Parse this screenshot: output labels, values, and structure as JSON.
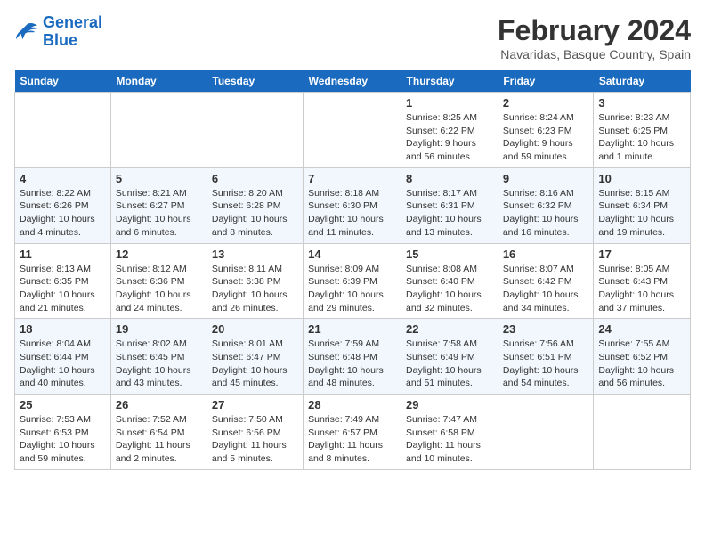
{
  "logo": {
    "line1": "General",
    "line2": "Blue"
  },
  "title": "February 2024",
  "subtitle": "Navaridas, Basque Country, Spain",
  "weekdays": [
    "Sunday",
    "Monday",
    "Tuesday",
    "Wednesday",
    "Thursday",
    "Friday",
    "Saturday"
  ],
  "weeks": [
    [
      {
        "day": "",
        "info": ""
      },
      {
        "day": "",
        "info": ""
      },
      {
        "day": "",
        "info": ""
      },
      {
        "day": "",
        "info": ""
      },
      {
        "day": "1",
        "info": "Sunrise: 8:25 AM\nSunset: 6:22 PM\nDaylight: 9 hours and 56 minutes."
      },
      {
        "day": "2",
        "info": "Sunrise: 8:24 AM\nSunset: 6:23 PM\nDaylight: 9 hours and 59 minutes."
      },
      {
        "day": "3",
        "info": "Sunrise: 8:23 AM\nSunset: 6:25 PM\nDaylight: 10 hours and 1 minute."
      }
    ],
    [
      {
        "day": "4",
        "info": "Sunrise: 8:22 AM\nSunset: 6:26 PM\nDaylight: 10 hours and 4 minutes."
      },
      {
        "day": "5",
        "info": "Sunrise: 8:21 AM\nSunset: 6:27 PM\nDaylight: 10 hours and 6 minutes."
      },
      {
        "day": "6",
        "info": "Sunrise: 8:20 AM\nSunset: 6:28 PM\nDaylight: 10 hours and 8 minutes."
      },
      {
        "day": "7",
        "info": "Sunrise: 8:18 AM\nSunset: 6:30 PM\nDaylight: 10 hours and 11 minutes."
      },
      {
        "day": "8",
        "info": "Sunrise: 8:17 AM\nSunset: 6:31 PM\nDaylight: 10 hours and 13 minutes."
      },
      {
        "day": "9",
        "info": "Sunrise: 8:16 AM\nSunset: 6:32 PM\nDaylight: 10 hours and 16 minutes."
      },
      {
        "day": "10",
        "info": "Sunrise: 8:15 AM\nSunset: 6:34 PM\nDaylight: 10 hours and 19 minutes."
      }
    ],
    [
      {
        "day": "11",
        "info": "Sunrise: 8:13 AM\nSunset: 6:35 PM\nDaylight: 10 hours and 21 minutes."
      },
      {
        "day": "12",
        "info": "Sunrise: 8:12 AM\nSunset: 6:36 PM\nDaylight: 10 hours and 24 minutes."
      },
      {
        "day": "13",
        "info": "Sunrise: 8:11 AM\nSunset: 6:38 PM\nDaylight: 10 hours and 26 minutes."
      },
      {
        "day": "14",
        "info": "Sunrise: 8:09 AM\nSunset: 6:39 PM\nDaylight: 10 hours and 29 minutes."
      },
      {
        "day": "15",
        "info": "Sunrise: 8:08 AM\nSunset: 6:40 PM\nDaylight: 10 hours and 32 minutes."
      },
      {
        "day": "16",
        "info": "Sunrise: 8:07 AM\nSunset: 6:42 PM\nDaylight: 10 hours and 34 minutes."
      },
      {
        "day": "17",
        "info": "Sunrise: 8:05 AM\nSunset: 6:43 PM\nDaylight: 10 hours and 37 minutes."
      }
    ],
    [
      {
        "day": "18",
        "info": "Sunrise: 8:04 AM\nSunset: 6:44 PM\nDaylight: 10 hours and 40 minutes."
      },
      {
        "day": "19",
        "info": "Sunrise: 8:02 AM\nSunset: 6:45 PM\nDaylight: 10 hours and 43 minutes."
      },
      {
        "day": "20",
        "info": "Sunrise: 8:01 AM\nSunset: 6:47 PM\nDaylight: 10 hours and 45 minutes."
      },
      {
        "day": "21",
        "info": "Sunrise: 7:59 AM\nSunset: 6:48 PM\nDaylight: 10 hours and 48 minutes."
      },
      {
        "day": "22",
        "info": "Sunrise: 7:58 AM\nSunset: 6:49 PM\nDaylight: 10 hours and 51 minutes."
      },
      {
        "day": "23",
        "info": "Sunrise: 7:56 AM\nSunset: 6:51 PM\nDaylight: 10 hours and 54 minutes."
      },
      {
        "day": "24",
        "info": "Sunrise: 7:55 AM\nSunset: 6:52 PM\nDaylight: 10 hours and 56 minutes."
      }
    ],
    [
      {
        "day": "25",
        "info": "Sunrise: 7:53 AM\nSunset: 6:53 PM\nDaylight: 10 hours and 59 minutes."
      },
      {
        "day": "26",
        "info": "Sunrise: 7:52 AM\nSunset: 6:54 PM\nDaylight: 11 hours and 2 minutes."
      },
      {
        "day": "27",
        "info": "Sunrise: 7:50 AM\nSunset: 6:56 PM\nDaylight: 11 hours and 5 minutes."
      },
      {
        "day": "28",
        "info": "Sunrise: 7:49 AM\nSunset: 6:57 PM\nDaylight: 11 hours and 8 minutes."
      },
      {
        "day": "29",
        "info": "Sunrise: 7:47 AM\nSunset: 6:58 PM\nDaylight: 11 hours and 10 minutes."
      },
      {
        "day": "",
        "info": ""
      },
      {
        "day": "",
        "info": ""
      }
    ]
  ]
}
